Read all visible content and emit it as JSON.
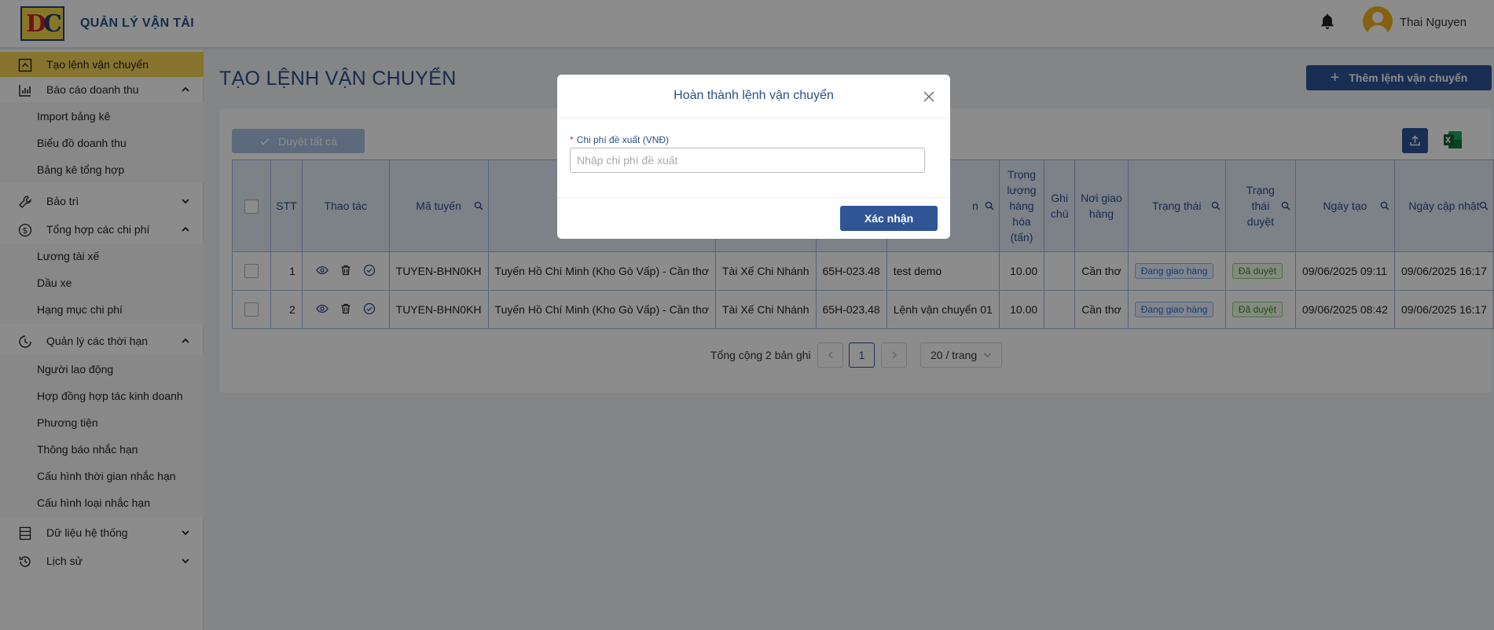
{
  "header": {
    "app_title": "QUẢN LÝ VẬN TẢI",
    "user_name": "Thai Nguyen"
  },
  "sidebar": {
    "items": [
      {
        "label": "Tạo lệnh vận chuyển",
        "icon": "upload-box-icon",
        "active": true
      },
      {
        "label": "Báo cáo doanh thu",
        "icon": "bar-chart-icon",
        "expanded": true,
        "children": [
          "Import bảng kê",
          "Biểu đồ doanh thu",
          "Bảng kê tổng hợp"
        ]
      },
      {
        "label": "Bảo trì",
        "icon": "wrench-icon",
        "expanded": false
      },
      {
        "label": "Tổng hợp các chi phí",
        "icon": "dollar-circle-icon",
        "expanded": true,
        "children": [
          "Lương tài xế",
          "Dầu xe",
          "Hạng mục chi phí"
        ]
      },
      {
        "label": "Quản lý các thời hạn",
        "icon": "clock-icon",
        "expanded": true,
        "children": [
          "Người lao động",
          "Hợp đồng hợp tác kinh doanh",
          "Phương tiện",
          "Thông báo nhắc hạn",
          "Cấu hình thời gian nhắc hạn",
          "Cấu hình loại nhắc hạn"
        ]
      },
      {
        "label": "Dữ liệu hệ thống",
        "icon": "database-icon",
        "expanded": false
      },
      {
        "label": "Lịch sử",
        "icon": "history-icon",
        "expanded": false
      }
    ]
  },
  "main": {
    "page_title": "TẠO LỆNH VẬN CHUYỂN",
    "add_button": "Thêm lệnh vận chuyển",
    "approve_all_button": "Duyệt tất cả",
    "table": {
      "columns": [
        "STT",
        "Thao tác",
        "Mã tuyến",
        "",
        "",
        "",
        "n",
        "Trọng lượng hàng hóa (tấn)",
        "Ghi chú",
        "Nơi giao hàng",
        "Trạng thái",
        "Trạng thái duyệt",
        "Ngày tạo",
        "Ngày cập nhật"
      ],
      "rows": [
        {
          "stt": "1",
          "route_code": "TUYEN-BHN0KH",
          "route_name": "Tuyến Hồ Chí Minh (Kho Gò Vấp) - Cần thơ",
          "driver": "Tài Xế Chi Nhánh",
          "plate": "65H-023.48",
          "order_name": "test demo",
          "weight": "10.00",
          "note": "",
          "delivery": "Cần thơ",
          "status": "Đang giao hàng",
          "approval": "Đã duyệt",
          "created": "09/06/2025 09:11",
          "updated": "09/06/2025 16:17"
        },
        {
          "stt": "2",
          "route_code": "TUYEN-BHN0KH",
          "route_name": "Tuyến Hồ Chí Minh (Kho Gò Vấp) - Cần thơ",
          "driver": "Tài Xế Chi Nhánh",
          "plate": "65H-023.48",
          "order_name": "Lệnh vận chuyển 01",
          "weight": "10.00",
          "note": "",
          "delivery": "Cần thơ",
          "status": "Đang giao hàng",
          "approval": "Đã duyệt",
          "created": "09/06/2025 08:42",
          "updated": "09/06/2025 16:17"
        }
      ]
    },
    "pagination": {
      "total_text": "Tổng cộng 2 bản ghi",
      "current_page": "1",
      "page_size": "20 / trang"
    }
  },
  "modal": {
    "title": "Hoàn thành lệnh vận chuyển",
    "field_label": "Chi phí đề xuất (VNĐ)",
    "field_placeholder": "Nhập chi phí đề xuất",
    "field_value": "",
    "confirm_button": "Xác nhận"
  },
  "colors": {
    "primary": "#2f5597",
    "active_menu": "#f5d457",
    "title_blue": "#2a4f8f",
    "avatar": "#f2b320",
    "required": "#e0272d"
  }
}
